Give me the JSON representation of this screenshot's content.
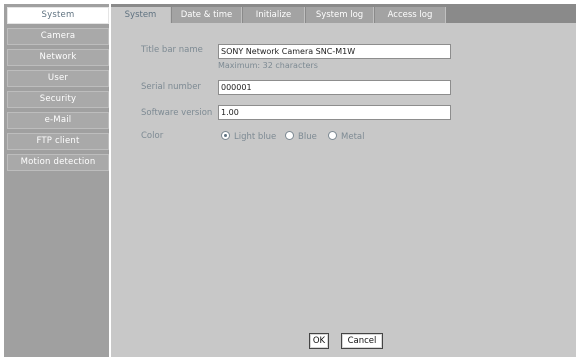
{
  "sidebar": {
    "items": [
      {
        "label": "System",
        "active": true
      },
      {
        "label": "Camera"
      },
      {
        "label": "Network"
      },
      {
        "label": "User"
      },
      {
        "label": "Security"
      },
      {
        "label": "e-Mail"
      },
      {
        "label": "FTP client"
      },
      {
        "label": "Motion detection"
      }
    ]
  },
  "tabs": [
    {
      "label": "System",
      "active": true
    },
    {
      "label": "Date & time"
    },
    {
      "label": "Initialize"
    },
    {
      "label": "System log"
    },
    {
      "label": "Access log"
    }
  ],
  "form": {
    "title_bar": {
      "label": "Title bar name",
      "value": "SONY Network Camera SNC-M1W",
      "hint": "Maximum: 32 characters"
    },
    "serial": {
      "label": "Serial number",
      "value": "000001"
    },
    "software": {
      "label": "Software version",
      "value": "1.00"
    },
    "color": {
      "label": "Color",
      "options": [
        "Light blue",
        "Blue",
        "Metal"
      ],
      "selected": "Light blue"
    }
  },
  "buttons": {
    "ok": "OK",
    "cancel": "Cancel"
  },
  "colors": {
    "sidebar_bg": "#a0a0a0",
    "content_bg": "#c8c8c8",
    "tabbar_bg": "#8a8a8a",
    "accent_text": "#5f7280"
  }
}
